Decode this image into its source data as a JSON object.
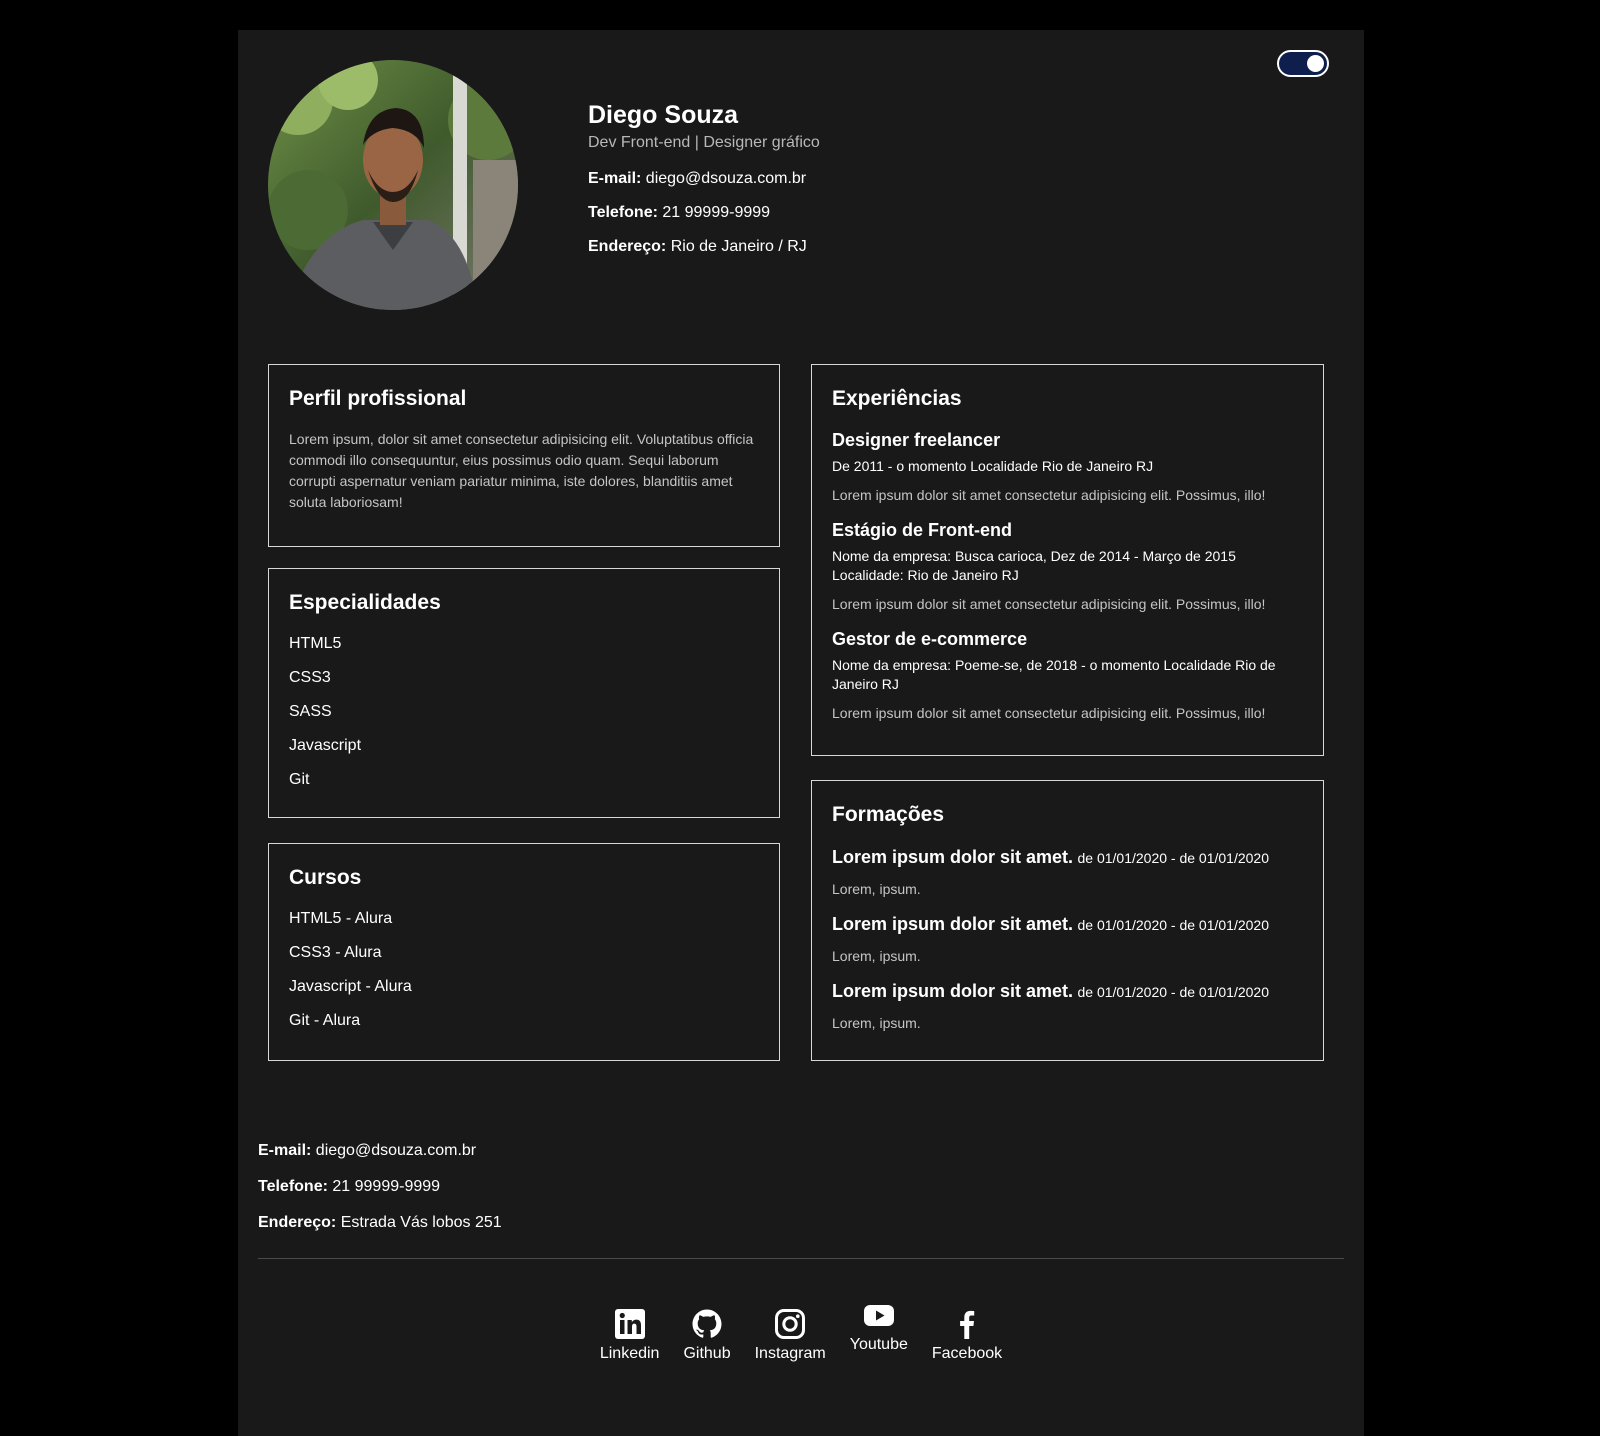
{
  "header": {
    "name": "Diego Souza",
    "role": "Dev Front-end | Designer gráfico",
    "email_label": "E-mail:",
    "email": "diego@dsouza.com.br",
    "phone_label": "Telefone:",
    "phone": "21 99999-9999",
    "address_label": "Endereço:",
    "address": "Rio de Janeiro / RJ"
  },
  "profile": {
    "title": "Perfil profissional",
    "text": "Lorem ipsum, dolor sit amet consectetur adipisicing elit. Voluptatibus officia commodi illo consequuntur, eius possimus odio quam. Sequi laborum corrupti aspernatur veniam pariatur minima, iste dolores, blanditiis amet soluta laboriosam!"
  },
  "specialties": {
    "title": "Especialidades",
    "items": [
      "HTML5",
      "CSS3",
      "SASS",
      "Javascript",
      "Git"
    ]
  },
  "courses": {
    "title": "Cursos",
    "items": [
      "HTML5 - Alura",
      "CSS3 - Alura",
      "Javascript - Alura",
      "Git - Alura"
    ]
  },
  "experiences": {
    "title": "Experiências",
    "items": [
      {
        "title": "Designer freelancer",
        "meta": "De 2011 - o momento Localidade Rio de Janeiro RJ",
        "desc": "Lorem ipsum dolor sit amet consectetur adipisicing elit. Possimus, illo!"
      },
      {
        "title": "Estágio de Front-end",
        "meta": "Nome da empresa: Busca carioca, Dez de 2014 - Março de 2015 Localidade: Rio de Janeiro RJ",
        "desc": "Lorem ipsum dolor sit amet consectetur adipisicing elit. Possimus, illo!"
      },
      {
        "title": "Gestor de e-commerce",
        "meta": "Nome da empresa: Poeme-se, de 2018 - o momento Localidade Rio de Janeiro RJ",
        "desc": "Lorem ipsum dolor sit amet consectetur adipisicing elit. Possimus, illo!"
      }
    ]
  },
  "education": {
    "title": "Formações",
    "items": [
      {
        "title": "Lorem ipsum dolor sit amet.",
        "dates": "de 01/01/2020 - de 01/01/2020",
        "desc": "Lorem, ipsum."
      },
      {
        "title": "Lorem ipsum dolor sit amet.",
        "dates": "de 01/01/2020 - de 01/01/2020",
        "desc": "Lorem, ipsum."
      },
      {
        "title": "Lorem ipsum dolor sit amet.",
        "dates": "de 01/01/2020 - de 01/01/2020",
        "desc": "Lorem, ipsum."
      }
    ]
  },
  "footer": {
    "email_label": "E-mail:",
    "email": "diego@dsouza.com.br",
    "phone_label": "Telefone:",
    "phone": "21 99999-9999",
    "address_label": "Endereço:",
    "address": "Estrada Vás lobos 251"
  },
  "social": [
    {
      "label": "Linkedin",
      "icon": "linkedin-icon"
    },
    {
      "label": "Github",
      "icon": "github-icon"
    },
    {
      "label": "Instagram",
      "icon": "instagram-icon"
    },
    {
      "label": "Youtube",
      "icon": "youtube-icon"
    },
    {
      "label": "Facebook",
      "icon": "facebook-icon"
    }
  ],
  "theme": {
    "page_bg": "#19191a",
    "toggle_bg": "#0f1f4d",
    "border": "#d7d7d7"
  }
}
